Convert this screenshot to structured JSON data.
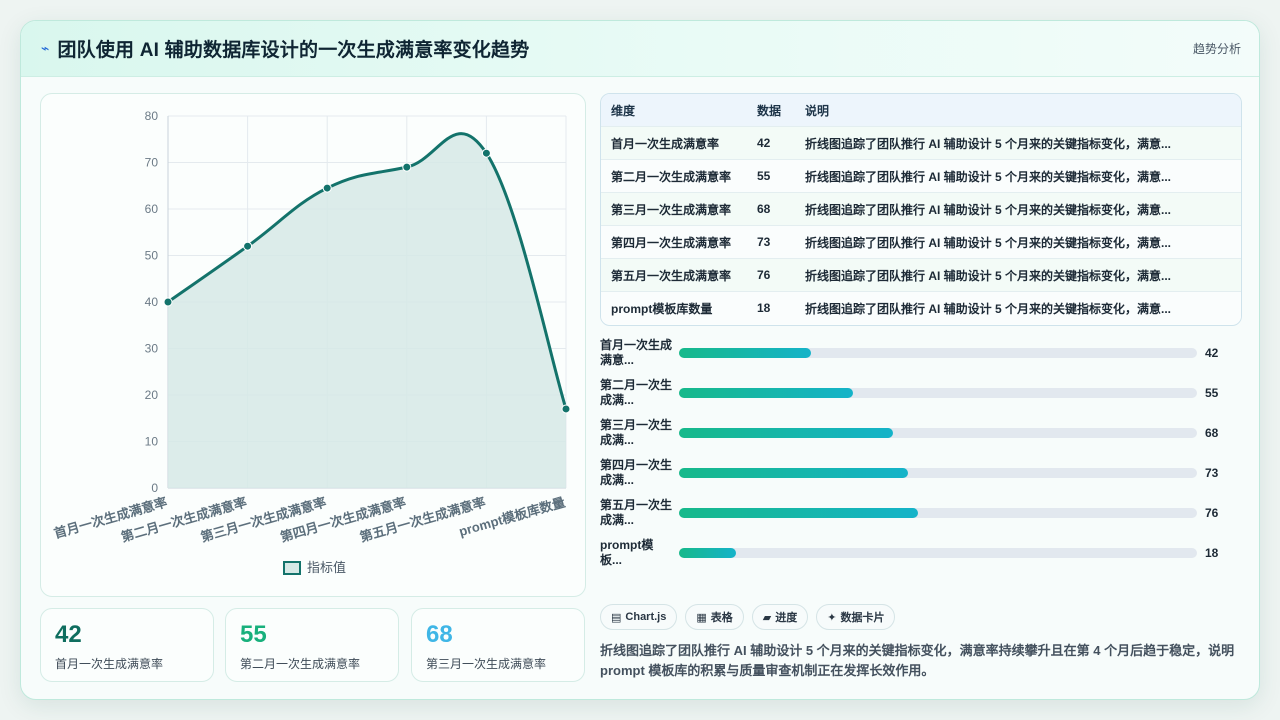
{
  "header": {
    "title": "团队使用 AI 辅助数据库设计的一次生成满意率变化趋势",
    "tag": "趋势分析"
  },
  "chart_data": {
    "type": "area",
    "categories": [
      "首月一次生成满意率",
      "第二月一次生成满意率",
      "第三月一次生成满意率",
      "第四月一次生成满意率",
      "第五月一次生成满意率",
      "prompt模板库数量"
    ],
    "series": [
      {
        "name": "指标值",
        "values": [
          40,
          52,
          64.5,
          69,
          72,
          17
        ]
      }
    ],
    "ylim": [
      0,
      80
    ],
    "yticks": [
      0,
      10,
      20,
      30,
      40,
      50,
      60,
      70,
      80
    ],
    "grid": true,
    "legend": "bottom",
    "colors": {
      "line": "#13736b",
      "fill": "#d6e9e6"
    }
  },
  "table": {
    "headers": [
      "维度",
      "数据",
      "说明"
    ],
    "rows": [
      {
        "name": "首月一次生成满意率",
        "value": "42",
        "desc": "折线图追踪了团队推行 AI 辅助设计 5 个月来的关键指标变化，满意..."
      },
      {
        "name": "第二月一次生成满意率",
        "value": "55",
        "desc": "折线图追踪了团队推行 AI 辅助设计 5 个月来的关键指标变化，满意..."
      },
      {
        "name": "第三月一次生成满意率",
        "value": "68",
        "desc": "折线图追踪了团队推行 AI 辅助设计 5 个月来的关键指标变化，满意..."
      },
      {
        "name": "第四月一次生成满意率",
        "value": "73",
        "desc": "折线图追踪了团队推行 AI 辅助设计 5 个月来的关键指标变化，满意..."
      },
      {
        "name": "第五月一次生成满意率",
        "value": "76",
        "desc": "折线图追踪了团队推行 AI 辅助设计 5 个月来的关键指标变化，满意..."
      },
      {
        "name": "prompt模板库数量",
        "value": "18",
        "desc": "折线图追踪了团队推行 AI 辅助设计 5 个月来的关键指标变化，满意..."
      }
    ]
  },
  "progress": [
    {
      "label1": "首月一次生成",
      "label2": "满意...",
      "value": 42,
      "pct": 0.255
    },
    {
      "label1": "第二月一次生",
      "label2": "成满...",
      "value": 55,
      "pct": 0.335
    },
    {
      "label1": "第三月一次生",
      "label2": "成满...",
      "value": 68,
      "pct": 0.413
    },
    {
      "label1": "第四月一次生",
      "label2": "成满...",
      "value": 73,
      "pct": 0.443
    },
    {
      "label1": "第五月一次生",
      "label2": "成满...",
      "value": 76,
      "pct": 0.462
    },
    {
      "label1": "prompt模",
      "label2": "板...",
      "value": 18,
      "pct": 0.11
    }
  ],
  "stats": [
    {
      "num": "42",
      "label": "首月一次生成满意率",
      "color": "#0f6e5f"
    },
    {
      "num": "55",
      "label": "第二月一次生成满意率",
      "color": "#18b07c"
    },
    {
      "num": "68",
      "label": "第三月一次生成满意率",
      "color": "#3fb6e6"
    }
  ],
  "chips": [
    {
      "icon": "▤",
      "label": "Chart.js"
    },
    {
      "icon": "▦",
      "label": "表格"
    },
    {
      "icon": "▰",
      "label": "进度"
    },
    {
      "icon": "✦",
      "label": "数据卡片"
    }
  ],
  "summary": "折线图追踪了团队推行 AI 辅助设计 5 个月来的关键指标变化，满意率持续攀升且在第 4 个月后趋于稳定，说明 prompt 模板库的积累与质量审查机制正在发挥长效作用。"
}
